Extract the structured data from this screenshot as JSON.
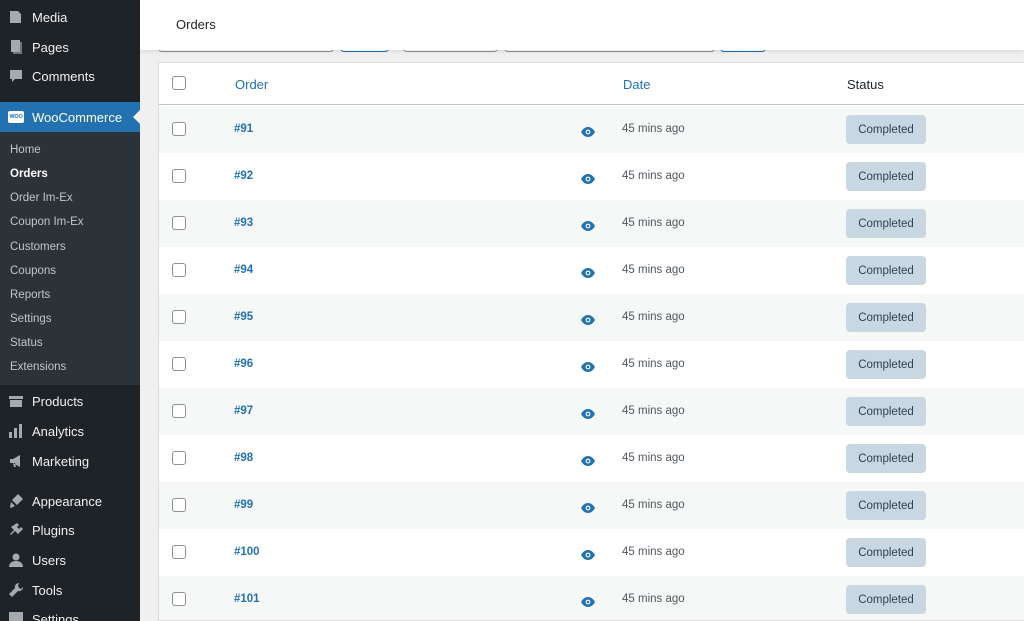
{
  "sidebar": {
    "top_items": [
      {
        "label": "Media",
        "icon": "media-icon"
      },
      {
        "label": "Pages",
        "icon": "pages-icon"
      },
      {
        "label": "Comments",
        "icon": "comments-icon"
      }
    ],
    "woocommerce": {
      "label": "WooCommerce",
      "icon": "woocommerce-icon",
      "badge": "WOO"
    },
    "submenu": [
      {
        "label": "Home"
      },
      {
        "label": "Orders",
        "current": true
      },
      {
        "label": "Order Im-Ex"
      },
      {
        "label": "Coupon Im-Ex"
      },
      {
        "label": "Customers"
      },
      {
        "label": "Coupons"
      },
      {
        "label": "Reports"
      },
      {
        "label": "Settings"
      },
      {
        "label": "Status"
      },
      {
        "label": "Extensions"
      }
    ],
    "bottom_items": [
      {
        "label": "Products",
        "icon": "products-icon"
      },
      {
        "label": "Analytics",
        "icon": "analytics-icon"
      },
      {
        "label": "Marketing",
        "icon": "marketing-icon"
      },
      {
        "label": "Appearance",
        "icon": "appearance-icon"
      },
      {
        "label": "Plugins",
        "icon": "plugins-icon"
      },
      {
        "label": "Users",
        "icon": "users-icon"
      },
      {
        "label": "Tools",
        "icon": "tools-icon"
      },
      {
        "label": "Settings",
        "icon": "settings-icon"
      }
    ]
  },
  "header": {
    "title": "Orders"
  },
  "table": {
    "columns": {
      "order": "Order",
      "date": "Date",
      "status": "Status"
    },
    "rows": [
      {
        "order": "#91",
        "date": "45 mins ago",
        "status": "Completed"
      },
      {
        "order": "#92",
        "date": "45 mins ago",
        "status": "Completed"
      },
      {
        "order": "#93",
        "date": "45 mins ago",
        "status": "Completed"
      },
      {
        "order": "#94",
        "date": "45 mins ago",
        "status": "Completed"
      },
      {
        "order": "#95",
        "date": "45 mins ago",
        "status": "Completed"
      },
      {
        "order": "#96",
        "date": "45 mins ago",
        "status": "Completed"
      },
      {
        "order": "#97",
        "date": "45 mins ago",
        "status": "Completed"
      },
      {
        "order": "#98",
        "date": "45 mins ago",
        "status": "Completed"
      },
      {
        "order": "#99",
        "date": "45 mins ago",
        "status": "Completed"
      },
      {
        "order": "#100",
        "date": "45 mins ago",
        "status": "Completed"
      },
      {
        "order": "#101",
        "date": "45 mins ago",
        "status": "Completed"
      }
    ]
  },
  "colors": {
    "sidebar_bg": "#1d2327",
    "submenu_bg": "#2c3338",
    "accent": "#2271b1",
    "status_completed_bg": "#c8d7e1",
    "status_completed_text": "#2e4453"
  }
}
